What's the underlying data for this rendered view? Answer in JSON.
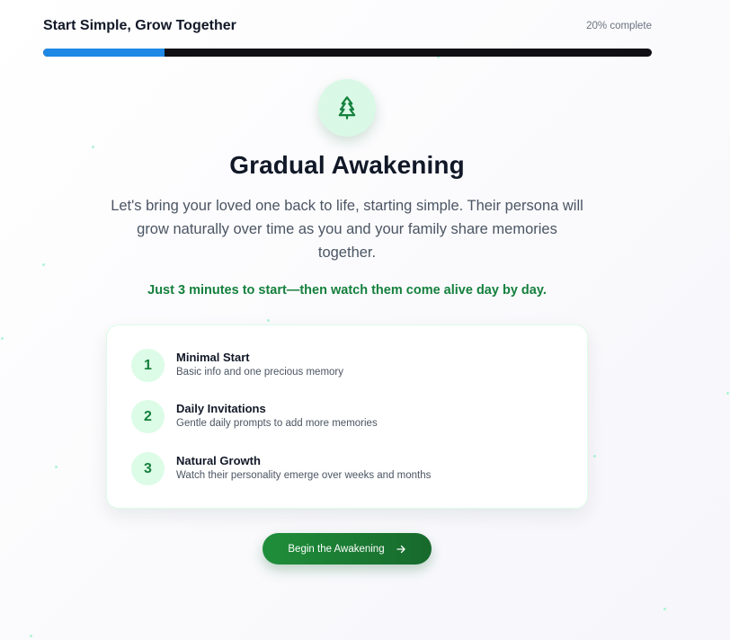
{
  "header": {
    "title": "Start Simple, Grow Together",
    "progress_label": "20% complete",
    "progress_fraction": 0.2,
    "progress_fill_color": "#1e88e5",
    "progress_track_color": "#0f0f14"
  },
  "hero": {
    "icon": "tree-icon",
    "accent_color": "#15803d",
    "title": "Gradual Awakening",
    "subtitle": "Let's bring your loved one back to life, starting simple. Their persona will grow naturally over time as you and your family share memories together.",
    "tagline": "Just 3 minutes to start—then watch them come alive day by day."
  },
  "steps": [
    {
      "number": "1",
      "title": "Minimal Start",
      "description": "Basic info and one precious memory"
    },
    {
      "number": "2",
      "title": "Daily Invitations",
      "description": "Gentle daily prompts to add more memories"
    },
    {
      "number": "3",
      "title": "Natural Growth",
      "description": "Watch their personality emerge over weeks and months"
    }
  ],
  "cta": {
    "label": "Begin the Awakening",
    "icon": "arrow-right-icon"
  }
}
